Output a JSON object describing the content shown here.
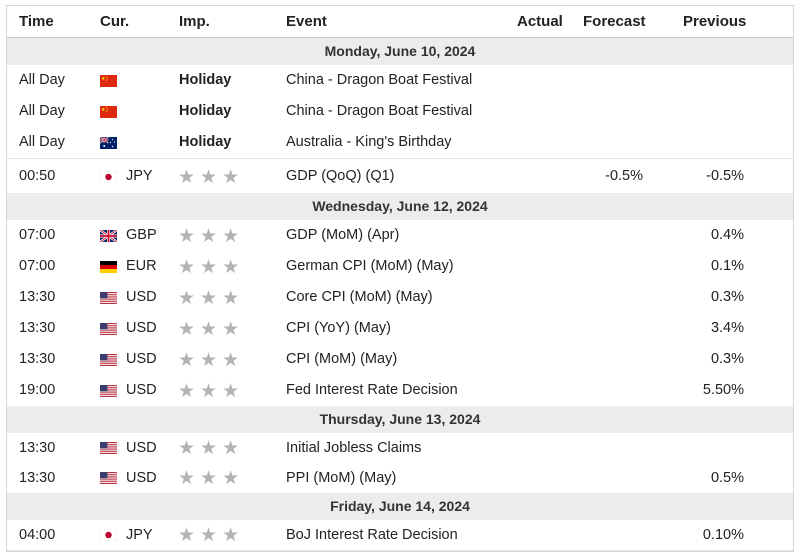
{
  "columns": {
    "time": "Time",
    "currency": "Cur.",
    "importance": "Imp.",
    "event": "Event",
    "actual": "Actual",
    "forecast": "Forecast",
    "previous": "Previous"
  },
  "colors": {
    "header_bg": "#ffffff",
    "date_row_bg": "#ececec",
    "star_gray": "#b3b3b3",
    "border": "#d6d6d6"
  },
  "days": [
    {
      "date": "Monday, June 10, 2024",
      "events": [
        {
          "time": "All Day",
          "flag": "china-flag-icon",
          "currency": "",
          "importance": "Holiday",
          "event": "China - Dragon Boat Festival",
          "actual": "",
          "forecast": "",
          "previous": ""
        },
        {
          "time": "All Day",
          "flag": "china-flag-icon",
          "currency": "",
          "importance": "Holiday",
          "event": "China - Dragon Boat Festival",
          "actual": "",
          "forecast": "",
          "previous": ""
        },
        {
          "time": "All Day",
          "flag": "australia-flag-icon",
          "currency": "",
          "importance": "Holiday",
          "event": "Australia - King's Birthday",
          "actual": "",
          "forecast": "",
          "previous": ""
        },
        {
          "time": "00:50",
          "flag": "japan-flag-icon",
          "currency": "JPY",
          "importance": "3",
          "event": "GDP (QoQ) (Q1)",
          "actual": "",
          "forecast": "-0.5%",
          "previous": "-0.5%"
        }
      ]
    },
    {
      "date": "Wednesday, June 12, 2024",
      "events": [
        {
          "time": "07:00",
          "flag": "uk-flag-icon",
          "currency": "GBP",
          "importance": "3",
          "event": "GDP (MoM) (Apr)",
          "actual": "",
          "forecast": "",
          "previous": "0.4%"
        },
        {
          "time": "07:00",
          "flag": "germany-flag-icon",
          "currency": "EUR",
          "importance": "3",
          "event": "German CPI (MoM) (May)",
          "actual": "",
          "forecast": "",
          "previous": "0.1%"
        },
        {
          "time": "13:30",
          "flag": "usa-flag-icon",
          "currency": "USD",
          "importance": "3",
          "event": "Core CPI (MoM) (May)",
          "actual": "",
          "forecast": "",
          "previous": "0.3%"
        },
        {
          "time": "13:30",
          "flag": "usa-flag-icon",
          "currency": "USD",
          "importance": "3",
          "event": "CPI (YoY) (May)",
          "actual": "",
          "forecast": "",
          "previous": "3.4%"
        },
        {
          "time": "13:30",
          "flag": "usa-flag-icon",
          "currency": "USD",
          "importance": "3",
          "event": "CPI (MoM) (May)",
          "actual": "",
          "forecast": "",
          "previous": "0.3%"
        },
        {
          "time": "19:00",
          "flag": "usa-flag-icon",
          "currency": "USD",
          "importance": "3",
          "event": "Fed Interest Rate Decision",
          "actual": "",
          "forecast": "",
          "previous": "5.50%"
        }
      ]
    },
    {
      "date": "Thursday, June 13, 2024",
      "events": [
        {
          "time": "13:30",
          "flag": "usa-flag-icon",
          "currency": "USD",
          "importance": "3",
          "event": "Initial Jobless Claims",
          "actual": "",
          "forecast": "",
          "previous": ""
        },
        {
          "time": "13:30",
          "flag": "usa-flag-icon",
          "currency": "USD",
          "importance": "3",
          "event": "PPI (MoM) (May)",
          "actual": "",
          "forecast": "",
          "previous": "0.5%"
        }
      ]
    },
    {
      "date": "Friday, June 14, 2024",
      "events": [
        {
          "time": "04:00",
          "flag": "japan-flag-icon",
          "currency": "JPY",
          "importance": "3",
          "event": "BoJ Interest Rate Decision",
          "actual": "",
          "forecast": "",
          "previous": "0.10%"
        }
      ]
    }
  ]
}
